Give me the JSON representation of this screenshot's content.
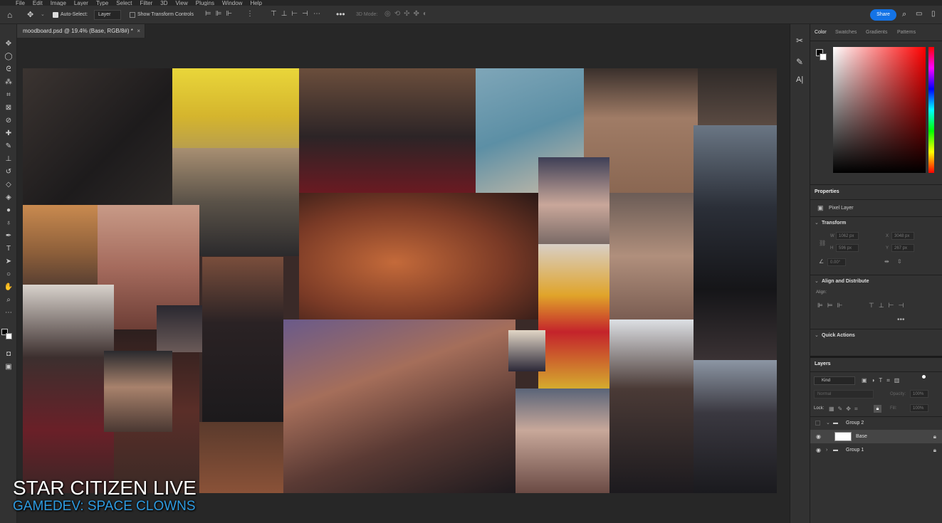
{
  "menubar": {
    "items": [
      "File",
      "Edit",
      "Image",
      "Layer",
      "Type",
      "Select",
      "Filter",
      "3D",
      "View",
      "Plugins",
      "Window",
      "Help"
    ]
  },
  "options_bar": {
    "auto_select_label": "Auto-Select:",
    "auto_select_value": "Layer",
    "show_transform_label": "Show Transform Controls",
    "mode_3d_label": "3D Mode:",
    "share_label": "Share"
  },
  "document": {
    "tab_title": "moodboard.psd @ 19.4% (Base, RGB/8#) *"
  },
  "color_panel": {
    "tabs": [
      "Color",
      "Swatches",
      "Gradients",
      "Patterns"
    ],
    "hue_color": "#ff0000"
  },
  "properties": {
    "title": "Properties",
    "layer_kind": "Pixel Layer",
    "transform_title": "Transform",
    "w_label": "W",
    "w_value": "1062 px",
    "h_label": "H",
    "h_value": "596 px",
    "x_label": "X",
    "x_value": "3048 px",
    "y_label": "Y",
    "y_value": "267 px",
    "angle_value": "0.00°",
    "align_title": "Align and Distribute",
    "align_label": "Align:",
    "quick_actions_title": "Quick Actions"
  },
  "layers": {
    "title": "Layers",
    "kind_label": "Kind",
    "blend_mode": "Normal",
    "opacity_label": "Opacity:",
    "opacity_value": "100%",
    "lock_label": "Lock:",
    "fill_label": "Fill:",
    "fill_value": "100%",
    "items": [
      {
        "name": "Group 2",
        "type": "group"
      },
      {
        "name": "Base",
        "type": "pixel"
      },
      {
        "name": "Group 1",
        "type": "group"
      }
    ]
  },
  "overlay": {
    "title": "STAR CITIZEN LIVE",
    "subtitle": "GAMEDEV: SPACE CLOWNS",
    "subtitle_color": "#2e9be0"
  }
}
